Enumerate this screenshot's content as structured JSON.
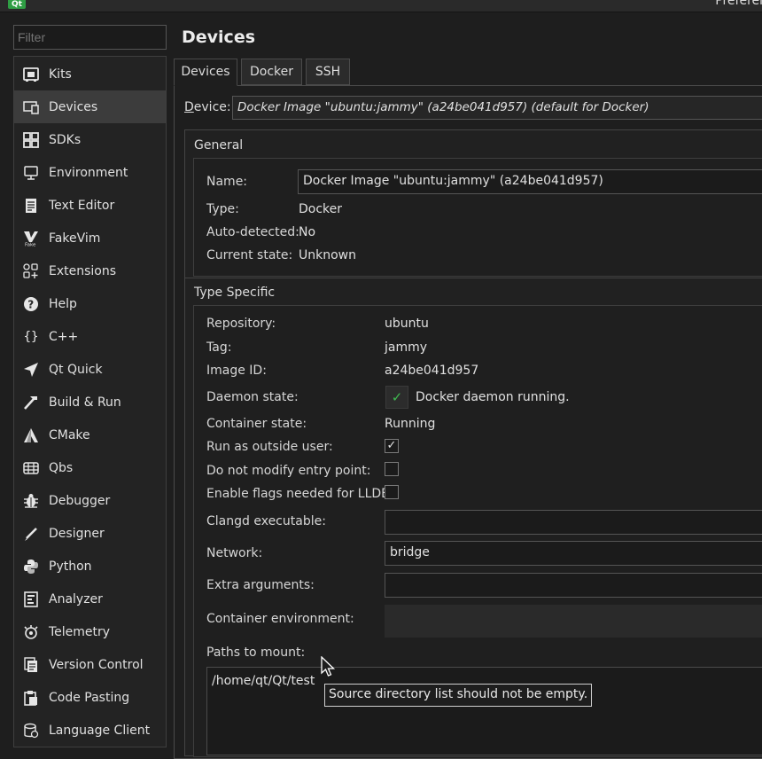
{
  "window": {
    "title": "Preferen",
    "logo_text": "Qt"
  },
  "filter": {
    "placeholder": "Filter"
  },
  "nav": {
    "items": [
      {
        "label": "Kits",
        "icon": "kits-icon"
      },
      {
        "label": "Devices",
        "icon": "devices-icon"
      },
      {
        "label": "SDKs",
        "icon": "sdks-icon"
      },
      {
        "label": "Environment",
        "icon": "environment-icon"
      },
      {
        "label": "Text Editor",
        "icon": "text-editor-icon"
      },
      {
        "label": "FakeVim",
        "icon": "fakevim-icon"
      },
      {
        "label": "Extensions",
        "icon": "extensions-icon"
      },
      {
        "label": "Help",
        "icon": "help-icon"
      },
      {
        "label": "C++",
        "icon": "cpp-icon"
      },
      {
        "label": "Qt Quick",
        "icon": "qt-quick-icon"
      },
      {
        "label": "Build & Run",
        "icon": "build-run-icon"
      },
      {
        "label": "CMake",
        "icon": "cmake-icon"
      },
      {
        "label": "Qbs",
        "icon": "qbs-icon"
      },
      {
        "label": "Debugger",
        "icon": "debugger-icon"
      },
      {
        "label": "Designer",
        "icon": "designer-icon"
      },
      {
        "label": "Python",
        "icon": "python-icon"
      },
      {
        "label": "Analyzer",
        "icon": "analyzer-icon"
      },
      {
        "label": "Telemetry",
        "icon": "telemetry-icon"
      },
      {
        "label": "Version Control",
        "icon": "version-control-icon"
      },
      {
        "label": "Code Pasting",
        "icon": "code-pasting-icon"
      },
      {
        "label": "Language Client",
        "icon": "language-client-icon"
      }
    ],
    "selected": "Devices"
  },
  "page": {
    "title": "Devices",
    "tabs": [
      {
        "label": "Devices"
      },
      {
        "label": "Docker"
      },
      {
        "label": "SSH"
      }
    ],
    "device_label_prefix": "D",
    "device_label_rest": "evice:",
    "device_value": "Docker Image \"ubuntu:jammy\" (a24be041d957) (default for Docker)"
  },
  "general": {
    "title": "General",
    "name_label": "Name:",
    "name_value": "Docker Image \"ubuntu:jammy\" (a24be041d957)",
    "type_label": "Type:",
    "type_value": "Docker",
    "auto_label": "Auto-detected:",
    "auto_value": "No",
    "state_label": "Current state:",
    "state_value": "Unknown"
  },
  "type_specific": {
    "title": "Type Specific",
    "repository_label": "Repository:",
    "repository_value": "ubuntu",
    "tag_label": "Tag:",
    "tag_value": "jammy",
    "image_id_label": "Image ID:",
    "image_id_value": "a24be041d957",
    "daemon_label": "Daemon state:",
    "daemon_value": "Docker daemon running.",
    "container_state_label": "Container state:",
    "container_state_value": "Running",
    "run_outside_label": "Run as outside user:",
    "run_outside_checked": true,
    "no_modify_label": "Do not modify entry point:",
    "no_modify_checked": false,
    "lldb_label": "Enable flags needed for LLDB:",
    "lldb_checked": false,
    "clangd_label": "Clangd executable:",
    "clangd_value": "",
    "network_label": "Network:",
    "network_value": "bridge",
    "extra_args_label": "Extra arguments:",
    "extra_args_value": "",
    "container_env_label": "Container environment:",
    "paths_label": "Paths to mount:",
    "paths": [
      "/home/qt/Qt/test"
    ]
  },
  "tooltip": {
    "text": "Source directory list should not be empty."
  }
}
